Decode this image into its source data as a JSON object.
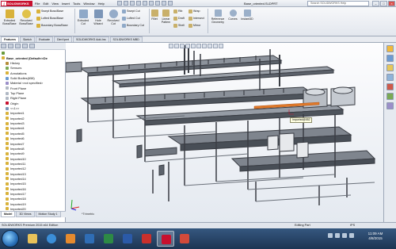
{
  "app": {
    "logo": "SOLIDWORKS",
    "document_title": "Base_oriented.SLDPRT",
    "search_placeholder": "Search SOLIDWORKS Help"
  },
  "menu": [
    "File",
    "Edit",
    "View",
    "Insert",
    "Tools",
    "Window",
    "Help"
  ],
  "toolbar": {
    "extruded_boss": "Extruded Boss/Base",
    "revolved_boss": "Revolved Boss/Base",
    "swept_boss": "Swept Boss/Base",
    "lofted_boss": "Lofted Boss/Base",
    "boundary_boss": "Boundary Boss/Base",
    "extruded_cut": "Extruded Cut",
    "hole_wizard": "Hole Wizard",
    "revolved_cut": "Revolved Cut",
    "swept_cut": "Swept Cut",
    "lofted_cut": "Lofted Cut",
    "boundary_cut": "Boundary Cut",
    "fillet": "Fillet",
    "linear_pattern": "Linear Pattern",
    "rib": "Rib",
    "draft": "Draft",
    "shell": "Shell",
    "wrap": "Wrap",
    "intersect": "Intersect",
    "mirror": "Mirror",
    "reference_geometry": "Reference Geometry",
    "curves": "Curves",
    "instant3d": "Instant3D"
  },
  "command_tabs": [
    "Features",
    "Sketch",
    "Evaluate",
    "DimXpert",
    "SOLIDWORKS Add-Ins",
    "SOLIDWORKS MBD"
  ],
  "tree": {
    "root": "Base_oriented (Default<<De",
    "items": [
      "History",
      "Sensors",
      "Annotations",
      "Solid Bodies(658)",
      "Material <not specified>",
      "Front Plane",
      "Top Plane",
      "Right Plane",
      "Origin",
      "<<1>>",
      "Imported1",
      "Imported2",
      "Imported3",
      "Imported4",
      "Imported5",
      "Imported6",
      "Imported7",
      "Imported8",
      "Imported9",
      "Imported10",
      "Imported11",
      "Imported12",
      "Imported13",
      "Imported14",
      "Imported15",
      "Imported16",
      "Imported17",
      "Imported18",
      "Imported19",
      "Imported20",
      "Imported21"
    ]
  },
  "panel_tabs": [
    "Model",
    "3D Views",
    "Motion Study 1"
  ],
  "viewport": {
    "callout": "Imported@552",
    "view_label": "*Trimetric"
  },
  "status": {
    "edition": "SOLIDWORKS Premium 2015 x64 Edition",
    "mode": "Editing Part",
    "units": "IPS"
  },
  "clock": {
    "time": "11:09 AM",
    "date": "4/8/2015"
  },
  "colors": {
    "brand_red": "#c8102e",
    "taskbar": "#1d3553",
    "model_lines": "#3a3d44",
    "highlight": "#e07a2a"
  },
  "icons": [
    "search-icon",
    "minimize-icon",
    "maximize-icon",
    "close-icon",
    "new-document-icon",
    "open-icon",
    "save-icon",
    "print-icon",
    "undo-icon",
    "rebuild-icon",
    "options-icon"
  ]
}
